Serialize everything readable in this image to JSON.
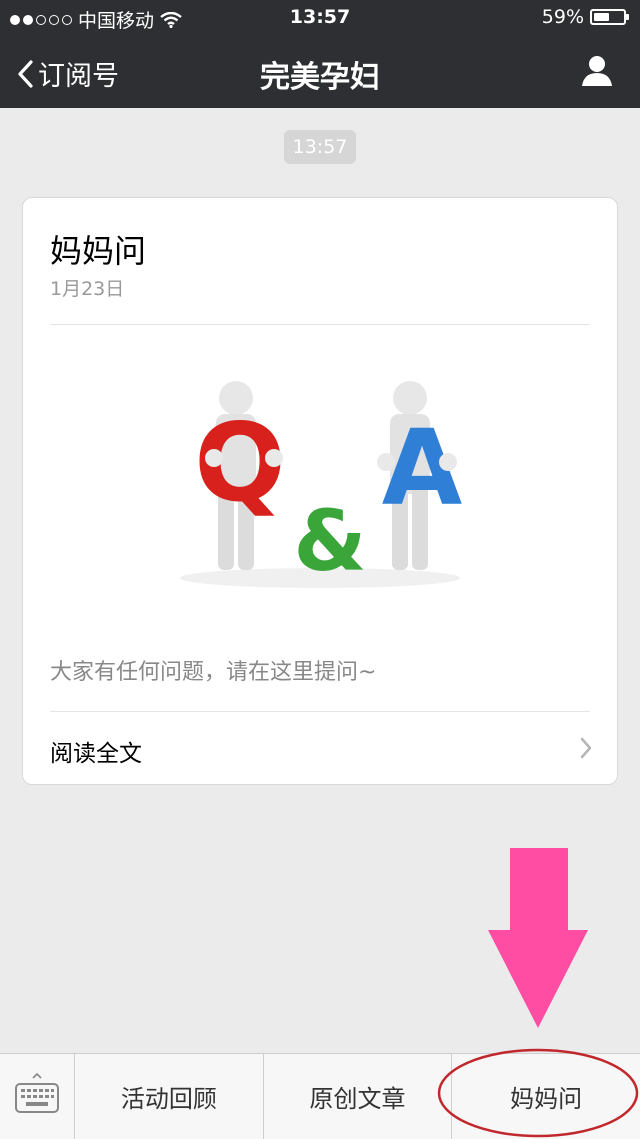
{
  "status_bar": {
    "carrier": "中国移动",
    "time": "13:57",
    "battery": "59%",
    "battery_level": 0.59,
    "signal_bars_filled": 2,
    "signal_bars_total": 5
  },
  "nav": {
    "back_label": "订阅号",
    "title": "完美孕妇"
  },
  "message": {
    "timestamp": "13:57",
    "card": {
      "title": "妈妈问",
      "date": "1月23日",
      "cover_letters": [
        "Q",
        "&",
        "A"
      ],
      "description": "大家有任何问题，请在这里提问~",
      "read_more": "阅读全文"
    }
  },
  "menu": {
    "items": [
      "活动回顾",
      "原创文章",
      "妈妈问"
    ]
  },
  "colors": {
    "nav_bg": "#2e2f33",
    "page_bg": "#ebebeb",
    "q_red": "#d8201c",
    "amp_green": "#3aa63a",
    "a_blue": "#2f7fd6",
    "arrow_pink": "#ff4da3",
    "circle_red": "#c0282d"
  }
}
